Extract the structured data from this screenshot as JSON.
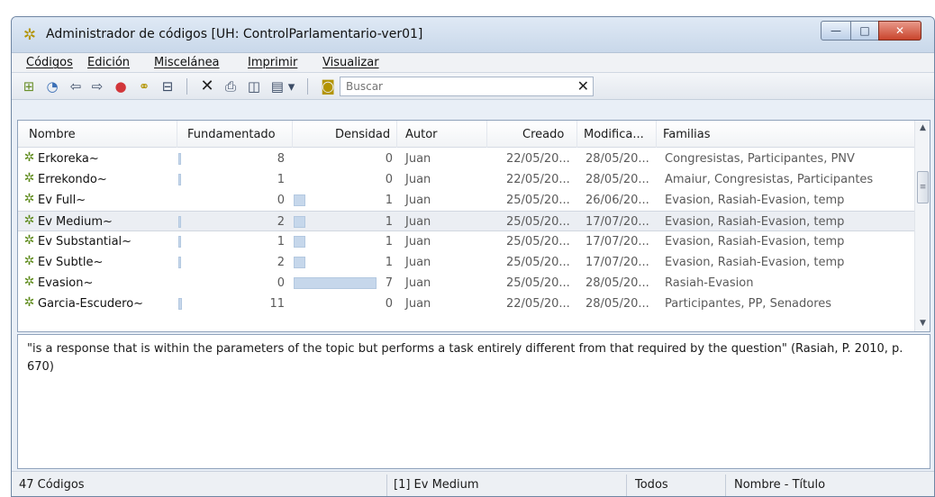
{
  "window": {
    "title": "Administrador de códigos [UH: ControlParlamentario-ver01]",
    "min_label": "—",
    "max_label": "□",
    "close_label": "✕"
  },
  "menu": [
    "Códigos",
    "Edición",
    "Miscelánea",
    "Imprimir",
    "Visualizar"
  ],
  "toolbar": {
    "icons": [
      "new-code-icon",
      "comment-icon",
      "back-arrow-icon",
      "forward-arrow-icon",
      "color-wheel-icon",
      "link-icon",
      "network-icon",
      "delete-icon",
      "print-icon",
      "panel-icon",
      "view-dropdown-icon",
      "filter-icon"
    ],
    "search_placeholder": "Buscar",
    "clear_label": "✕"
  },
  "table": {
    "columns": [
      "Nombre",
      "Fundamentado",
      "Densidad",
      "Autor",
      "Creado",
      "Modifica...",
      "Familias"
    ],
    "rows": [
      {
        "name": "Erkoreka~",
        "grounded": "8",
        "density": "0",
        "author": "Juan",
        "created": "22/05/20...",
        "modified": "28/05/20...",
        "families": "Congresistas, Participantes, PNV"
      },
      {
        "name": "Errekondo~",
        "grounded": "1",
        "density": "0",
        "author": "Juan",
        "created": "22/05/20...",
        "modified": "28/05/20...",
        "families": "Amaiur, Congresistas, Participantes"
      },
      {
        "name": "Ev Full~",
        "grounded": "0",
        "density": "1",
        "author": "Juan",
        "created": "25/05/20...",
        "modified": "26/06/20...",
        "families": "Evasion, Rasiah-Evasion, temp"
      },
      {
        "name": "Ev Medium~",
        "grounded": "2",
        "density": "1",
        "author": "Juan",
        "created": "25/05/20...",
        "modified": "17/07/20...",
        "families": "Evasion, Rasiah-Evasion, temp"
      },
      {
        "name": "Ev Substantial~",
        "grounded": "1",
        "density": "1",
        "author": "Juan",
        "created": "25/05/20...",
        "modified": "17/07/20...",
        "families": "Evasion, Rasiah-Evasion, temp"
      },
      {
        "name": "Ev Subtle~",
        "grounded": "2",
        "density": "1",
        "author": "Juan",
        "created": "25/05/20...",
        "modified": "17/07/20...",
        "families": "Evasion, Rasiah-Evasion, temp"
      },
      {
        "name": "Evasion~",
        "grounded": "0",
        "density": "7",
        "author": "Juan",
        "created": "25/05/20...",
        "modified": "28/05/20...",
        "families": "Rasiah-Evasion"
      },
      {
        "name": "Garcia-Escudero~",
        "grounded": "11",
        "density": "0",
        "author": "Juan",
        "created": "22/05/20...",
        "modified": "28/05/20...",
        "families": "Participantes, PP, Senadores"
      }
    ],
    "selected_index": 3
  },
  "comment": "\"is a response that is within the parameters of the topic but performs a task entirely different from that required by the question\" (Rasiah, P. 2010, p. 670)",
  "status": {
    "count": "47 Códigos",
    "current": "[1] Ev Medium",
    "filter": "Todos",
    "sort": "Nombre - Título"
  }
}
